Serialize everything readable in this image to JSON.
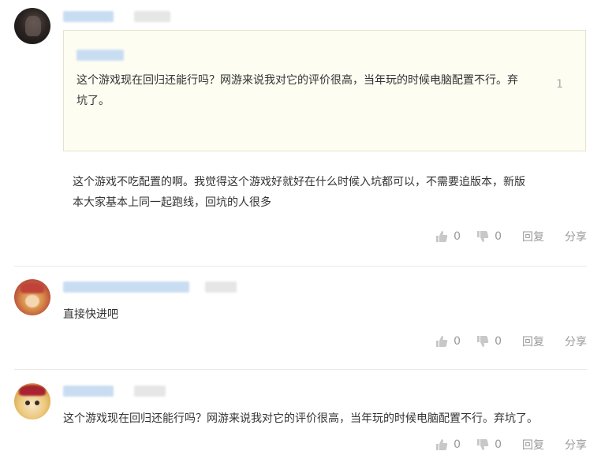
{
  "comments": [
    {
      "quote": {
        "floor": "1",
        "line1": "这个游戏现在回归还能行吗？网游来说我对它的评价很高，当年玩的时候电脑配置不行。弃",
        "line2": "坑了。"
      },
      "line1": "这个游戏不吃配置的啊。我觉得这个游戏好就好在什么时候入坑都可以，不需要追版本，新版",
      "line2": "本大家基本上同一起跑线，回坑的人很多",
      "likes": "0",
      "dislikes": "0",
      "reply_label": "回复",
      "share_label": "分享"
    },
    {
      "line1": "直接快进吧",
      "likes": "0",
      "dislikes": "0",
      "reply_label": "回复",
      "share_label": "分享"
    },
    {
      "line1": "这个游戏现在回归还能行吗？网游来说我对它的评价很高，当年玩的时候电脑配置不行。弃坑了。",
      "likes": "0",
      "dislikes": "0",
      "reply_label": "回复",
      "share_label": "分享"
    }
  ],
  "icons": {
    "like": "thumbs-up-icon",
    "dislike": "thumbs-down-icon"
  },
  "colors": {
    "quote_bg": "#fdfdf2",
    "quote_border": "#e5e3cf",
    "meta_gray": "#999999",
    "blur_blue": "#c9ddf2"
  }
}
